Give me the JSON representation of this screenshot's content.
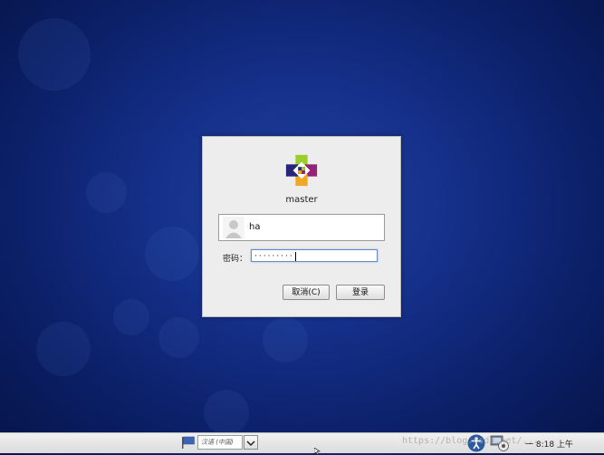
{
  "login": {
    "hostname": "master",
    "username": "ha",
    "password_label": "密码：",
    "password_mask": "·········",
    "cancel_label": "取消(C)",
    "login_label": "登录"
  },
  "taskbar": {
    "language": "汉语 (中国)",
    "clock": "一 8:18 上午"
  },
  "watermark": "https://blog.csdn.net/..."
}
